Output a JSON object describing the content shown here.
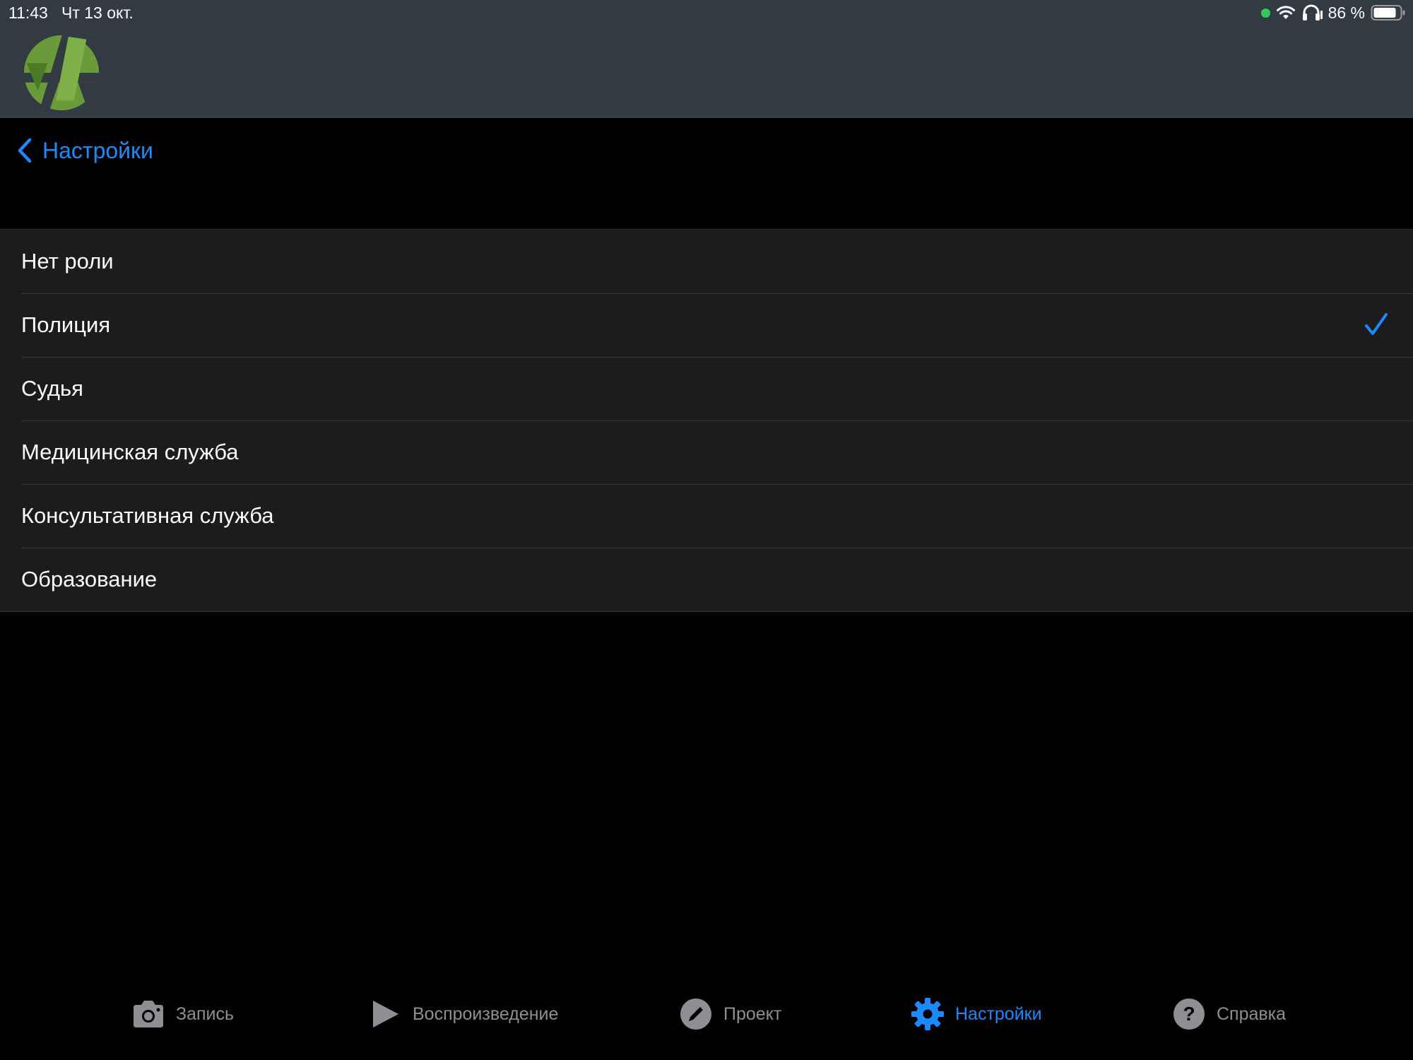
{
  "status_bar": {
    "time": "11:43",
    "date": "Чт 13 окт.",
    "battery_percent": "86 %",
    "battery_level": 0.86,
    "icons": [
      "mic-active-dot",
      "wifi-icon",
      "headphones-icon",
      "battery-icon"
    ]
  },
  "navigation": {
    "back_label": "Настройки"
  },
  "roles": {
    "selected_index": 1,
    "items": [
      {
        "label": "Нет роли"
      },
      {
        "label": "Полиция"
      },
      {
        "label": "Судья"
      },
      {
        "label": "Медицинская служба"
      },
      {
        "label": "Консультативная служба"
      },
      {
        "label": "Образование"
      }
    ]
  },
  "tab_bar": {
    "active": "settings",
    "tabs": [
      {
        "id": "record",
        "label": "Запись",
        "icon": "camera-icon"
      },
      {
        "id": "playback",
        "label": "Воспроизведение",
        "icon": "play-icon"
      },
      {
        "id": "project",
        "label": "Проект",
        "icon": "pencil-icon"
      },
      {
        "id": "settings",
        "label": "Настройки",
        "icon": "gear-icon"
      },
      {
        "id": "help",
        "label": "Справка",
        "icon": "question-icon"
      }
    ]
  },
  "colors": {
    "accent": "#1b8aff",
    "header_bg": "#323a42",
    "list_bg": "#1c1c1e",
    "inactive_tab": "#8e8e93",
    "mic_dot": "#34c759",
    "logo_green": "#6a9a3a"
  }
}
